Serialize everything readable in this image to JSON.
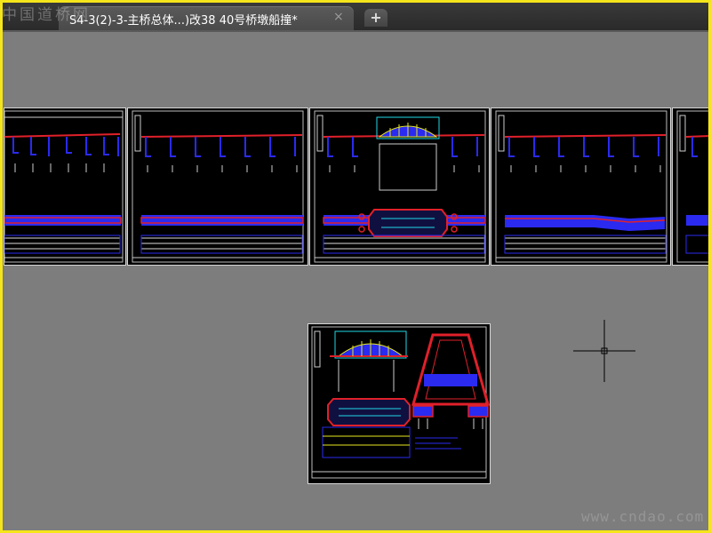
{
  "app": {
    "tab": {
      "title": "S4-3(2)-3-主桥总体...)改38 40号桥墩船撞*",
      "close_icon": "close-icon",
      "close_glyph": "×"
    },
    "new_tab": {
      "icon": "plus-icon",
      "glyph": "+"
    }
  },
  "watermarks": {
    "top": "中国道桥网",
    "bottom": "www.cndao.com"
  },
  "colors": {
    "border": "#f5e51b",
    "canvas": "#7d7d7d",
    "sheet_background": "#000000",
    "red": "#e0202a",
    "blue": "#2a2af0",
    "cyan": "#20d8e6",
    "yellow": "#e8e820"
  },
  "layouts": [
    {
      "name": "sheet-1"
    },
    {
      "name": "sheet-2"
    },
    {
      "name": "sheet-3"
    },
    {
      "name": "sheet-4"
    },
    {
      "name": "sheet-5"
    },
    {
      "name": "sheet-6"
    }
  ]
}
